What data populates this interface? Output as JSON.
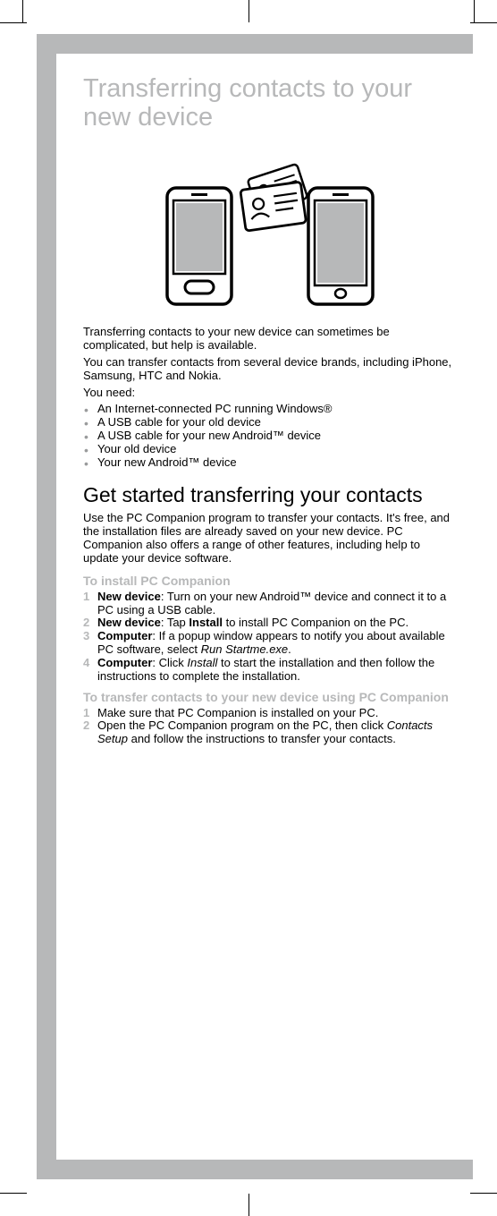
{
  "title": "Transferring contacts to your new device",
  "intro_p1": "Transferring contacts to your new device can sometimes be complicated, but help is available.",
  "intro_p2": "You can transfer contacts from several device brands, including iPhone, Samsung, HTC and Nokia.",
  "you_need_label": "You need:",
  "bullets": [
    "An Internet-connected PC running Windows®",
    "A USB cable for your old device",
    "A USB cable for your new Android™ device",
    "Your old device",
    "Your new Android™ device"
  ],
  "h2": "Get started transferring your contacts",
  "para2": "Use the PC Companion program to transfer your contacts. It's free, and the installation files are already saved on your new device. PC Companion also offers a range of other features, including help to update your device software.",
  "sub1": "To install PC Companion",
  "steps1": [
    {
      "n": "1",
      "bold": "New device",
      "rest": ": Turn on your new Android™ device and connect it to a PC using a USB cable."
    },
    {
      "n": "2",
      "bold": "New device",
      "rest_a": ": Tap ",
      "bold2": "Install",
      "rest_b": " to install PC Companion on the PC."
    },
    {
      "n": "3",
      "bold": "Computer",
      "rest_a": ": If a popup window appears to notify you about available PC software, select ",
      "ital": "Run Startme.exe",
      "rest_b": "."
    },
    {
      "n": "4",
      "bold": "Computer",
      "rest_a": ": Click ",
      "ital": "Install",
      "rest_b": " to start the installation and then follow the instructions to complete the installation."
    }
  ],
  "sub2": "To transfer contacts to your new device using PC Companion",
  "steps2": [
    {
      "n": "1",
      "text": "Make sure that PC Companion is installed on your PC."
    },
    {
      "n": "2",
      "text_a": "Open the PC Companion program on the PC, then click ",
      "ital": "Contacts Setup",
      "text_b": " and follow the instructions to transfer your contacts."
    }
  ]
}
